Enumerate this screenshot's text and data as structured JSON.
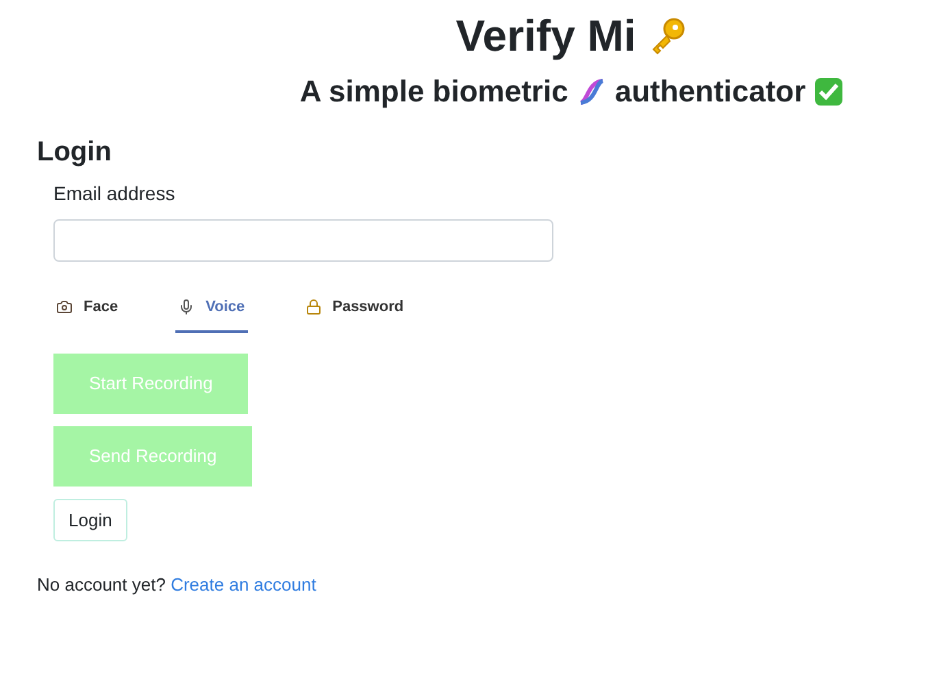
{
  "header": {
    "title": "Verify Mi",
    "subtitle_before": "A simple biometric",
    "subtitle_after": "authenticator"
  },
  "form": {
    "heading": "Login",
    "email_label": "Email address"
  },
  "tabs": [
    {
      "label": "Face",
      "kind": "camera",
      "selected": false
    },
    {
      "label": "Voice",
      "kind": "mic",
      "selected": true
    },
    {
      "label": "Password",
      "kind": "lock",
      "selected": false
    }
  ],
  "actions": [
    {
      "label": "Start Recording",
      "disabled": true
    },
    {
      "label": "Send Recording",
      "disabled": true
    }
  ],
  "login_button": "Login",
  "footer": {
    "text": "No account yet?",
    "link": "Create an account"
  }
}
